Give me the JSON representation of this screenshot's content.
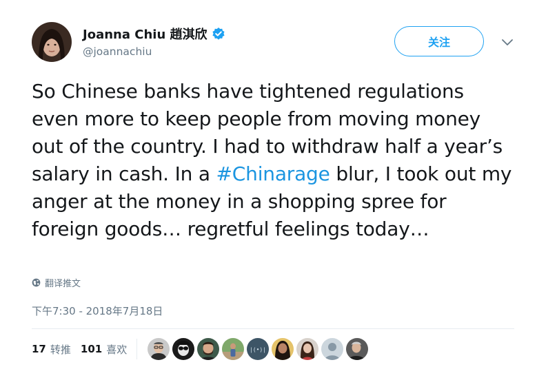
{
  "author": {
    "display_name": "Joanna Chiu 趙淇欣",
    "handle": "@joannachiu",
    "verified_icon": "verified-badge-icon"
  },
  "follow_button": {
    "label": "关注"
  },
  "tweet": {
    "text_before": "So Chinese banks have tightened regulations even more to keep people from moving money out of the country. I had to withdraw half a year’s salary in cash. In a ",
    "hashtag": "#Chinarage",
    "text_after": " blur, I took out my anger at the money in a shopping spree for foreign goods… regretful feelings today…"
  },
  "translate": {
    "label": "翻译推文",
    "icon": "globe-icon"
  },
  "timestamp": "下午7:30 - 2018年7月18日",
  "stats": {
    "retweets_count": "17",
    "retweets_label": "转推",
    "likes_count": "101",
    "likes_label": "喜欢"
  },
  "colors": {
    "accent": "#1da1f2",
    "hashtag": "#1b95e0",
    "secondary_text": "#657786",
    "divider": "#e6ecf0"
  }
}
